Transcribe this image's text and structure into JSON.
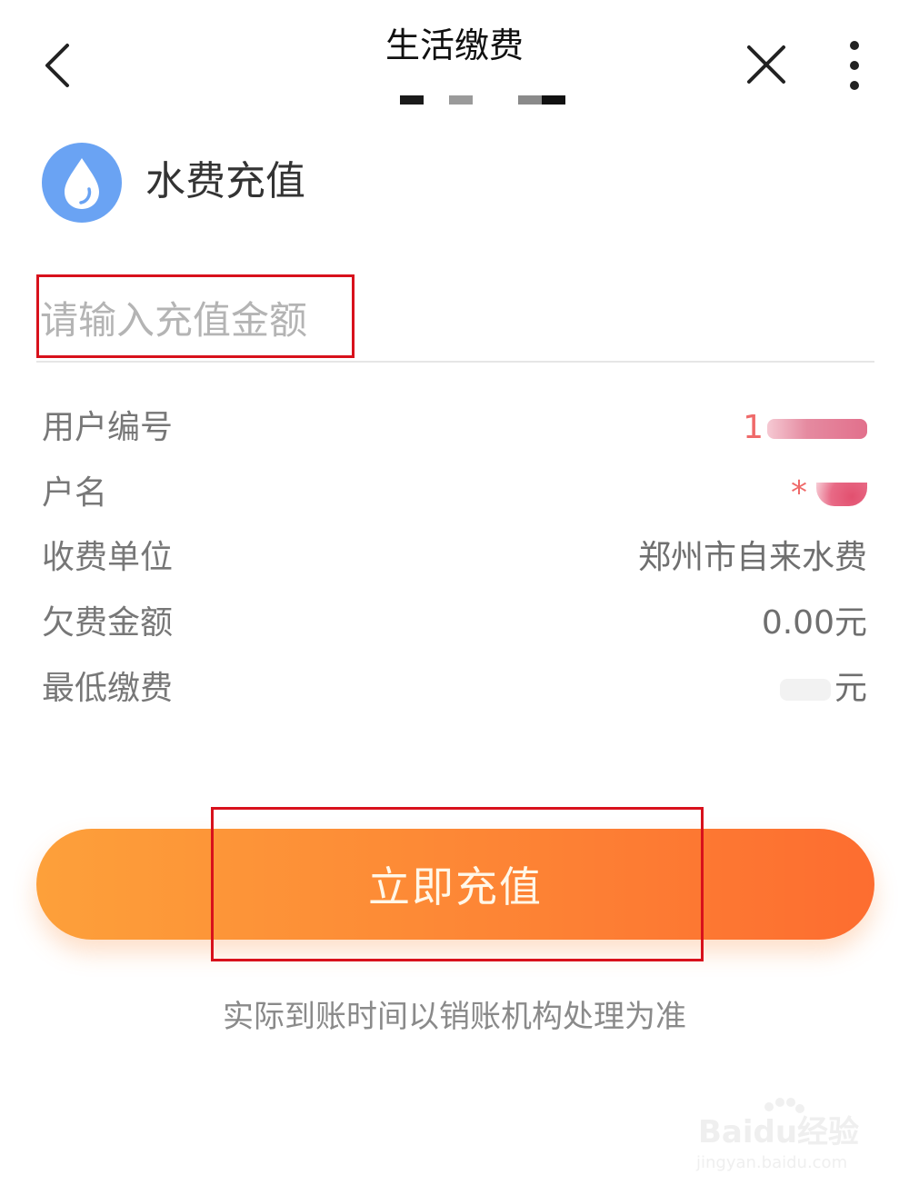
{
  "header": {
    "title": "生活缴费"
  },
  "service": {
    "title": "水费充值",
    "icon": "water-drop-icon",
    "icon_color": "#6aa3f3"
  },
  "amount_input": {
    "placeholder": "请输入充值金额",
    "value": ""
  },
  "info_rows": [
    {
      "label": "用户编号",
      "value": "1"
    },
    {
      "label": "户名",
      "value": "*"
    },
    {
      "label": "收费单位",
      "value": "郑州市自来水费"
    },
    {
      "label": "欠费金额",
      "value": "0.00元"
    },
    {
      "label": "最低缴费",
      "value": "元"
    }
  ],
  "actions": {
    "recharge_label": "立即充值",
    "recharge_gradient": [
      "#fda03a",
      "#fd6d30"
    ]
  },
  "footer": {
    "note": "实际到账时间以销账机构处理为准"
  },
  "watermark": {
    "brand": "Baidu经验",
    "url": "jingyan.baidu.com"
  },
  "colors": {
    "annotation_box": "#d8111c",
    "text_primary": "#333333",
    "text_secondary": "#777777"
  }
}
